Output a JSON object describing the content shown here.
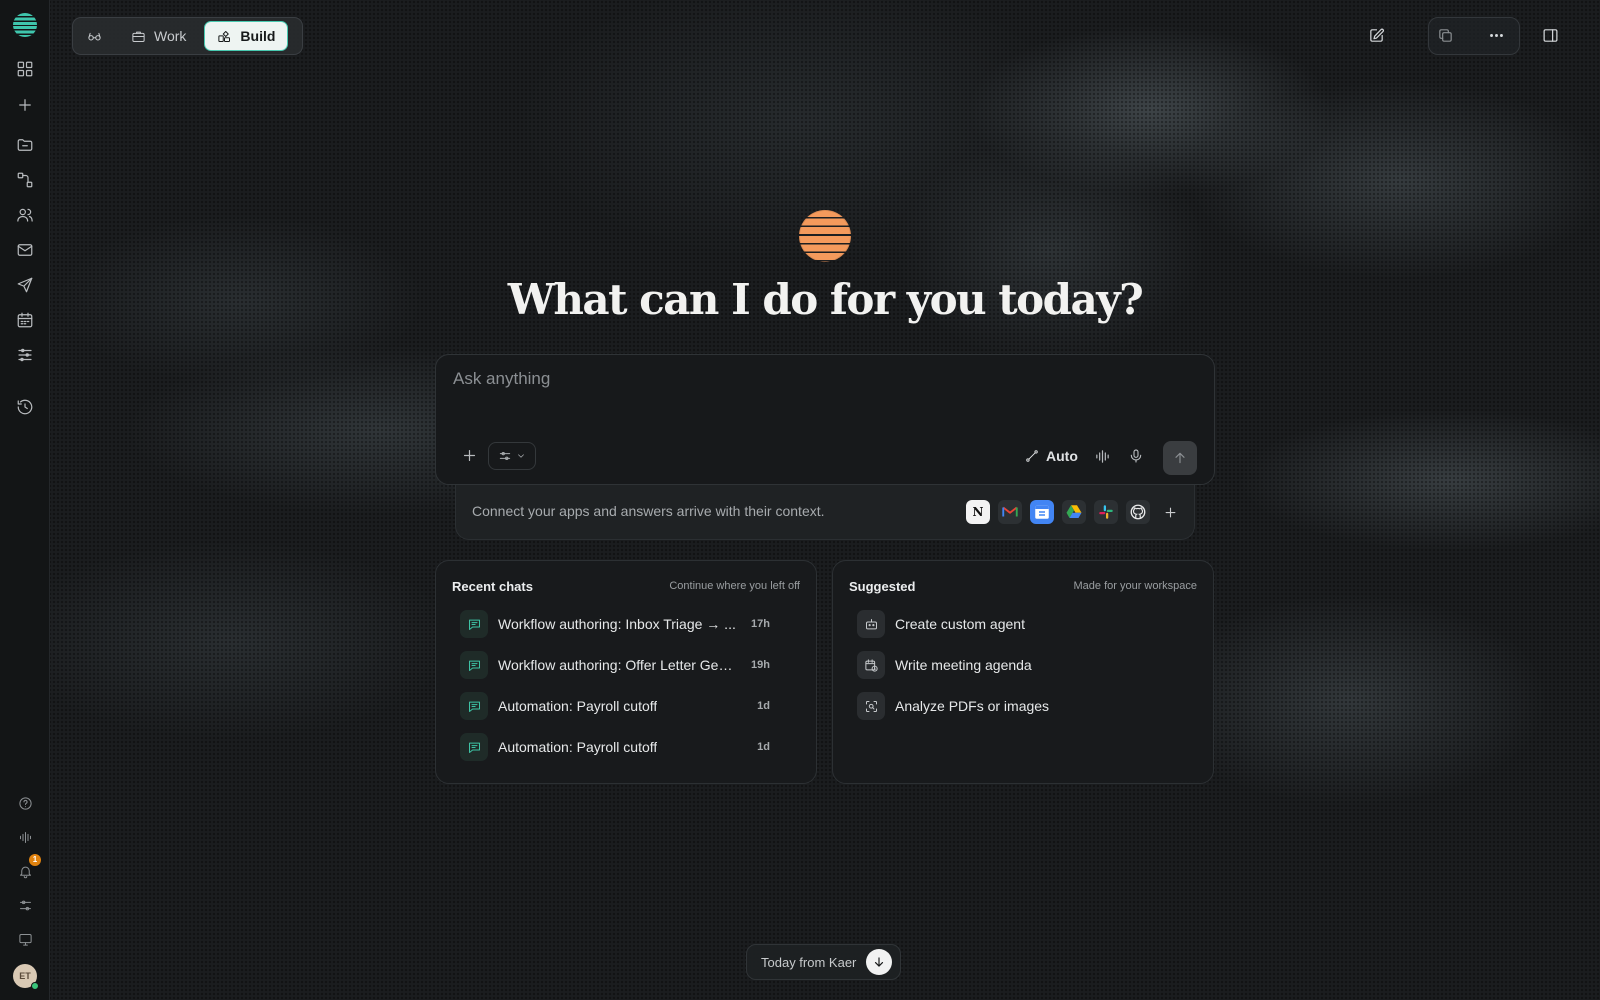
{
  "modes": [
    {
      "label": ""
    },
    {
      "label": "Work"
    },
    {
      "label": "Build"
    }
  ],
  "hero": {
    "title": "What can I do for you today?"
  },
  "composer": {
    "placeholder": "Ask anything",
    "mode_label": "Auto"
  },
  "connect": {
    "text": "Connect your apps and answers arrive with their context.",
    "apps": [
      "notion-icon",
      "gmail-icon",
      "google-calendar-icon",
      "google-drive-icon",
      "slack-icon",
      "github-icon"
    ]
  },
  "recent": {
    "title": "Recent chats",
    "subtitle": "Continue where you left off",
    "items": [
      {
        "label": "Workflow authoring: Inbox Triage → ...",
        "time": "17h"
      },
      {
        "label": "Workflow authoring: Offer Letter Gen...",
        "time": "19h"
      },
      {
        "label": "Automation: Payroll cutoff",
        "time": "1d"
      },
      {
        "label": "Automation: Payroll cutoff",
        "time": "1d"
      }
    ]
  },
  "suggested": {
    "title": "Suggested",
    "subtitle": "Made for your workspace",
    "items": [
      {
        "label": "Create custom agent",
        "icon": "robot-icon"
      },
      {
        "label": "Write meeting agenda",
        "icon": "calendar-clock-icon"
      },
      {
        "label": "Analyze PDFs or images",
        "icon": "scan-icon"
      }
    ]
  },
  "footer": {
    "today_label": "Today from Kaer"
  },
  "rail": {
    "notification_count": "1",
    "avatar_initials": "ET"
  },
  "colors": {
    "accent_teal": "#3fc6ad",
    "hero_orange": "#f49a5c",
    "badge_orange": "#e0820f"
  }
}
